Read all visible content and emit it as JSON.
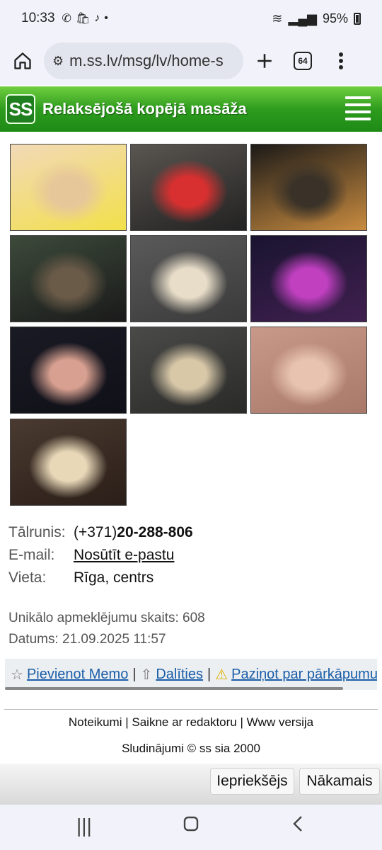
{
  "status": {
    "time": "10:33",
    "battery": "95%"
  },
  "browser": {
    "url": "m.ss.lv/msg/lv/home-s",
    "tab_count": "64"
  },
  "header": {
    "logo": "SS",
    "title": "Relaksējošā kopējā masāža"
  },
  "photos": [
    {
      "alt": "photo-1",
      "colors": [
        "#f2d9b8",
        "#e6c79a",
        "#f2e04a"
      ]
    },
    {
      "alt": "photo-2",
      "colors": [
        "#5a5550",
        "#d83030",
        "#222"
      ]
    },
    {
      "alt": "photo-3",
      "colors": [
        "#1c1a18",
        "#3a3228",
        "#c98c40"
      ]
    },
    {
      "alt": "photo-4",
      "colors": [
        "#3c4a3a",
        "#6a5a48",
        "#1a1a1a"
      ]
    },
    {
      "alt": "photo-5",
      "colors": [
        "#5a5a5a",
        "#e8ddc8",
        "#3a3a3a"
      ]
    },
    {
      "alt": "photo-6",
      "colors": [
        "#1a1430",
        "#c040c0",
        "#402050"
      ]
    },
    {
      "alt": "photo-7",
      "colors": [
        "#1a1a24",
        "#d8a090",
        "#101018"
      ]
    },
    {
      "alt": "photo-8",
      "colors": [
        "#4a4a48",
        "#d8c8a8",
        "#2a2a28"
      ]
    },
    {
      "alt": "photo-9",
      "colors": [
        "#c89888",
        "#e8c4b0",
        "#a87868"
      ]
    },
    {
      "alt": "photo-10",
      "colors": [
        "#4a3a30",
        "#e8d8b8",
        "#2a1e18"
      ]
    }
  ],
  "info": {
    "phone_label": "Tālrunis:",
    "phone_prefix": "(+371)",
    "phone_number": "20-288-806",
    "email_label": "E-mail:",
    "email_link": "Nosūtīt e-pastu",
    "location_label": "Vieta:",
    "location_value": "Rīga, centrs"
  },
  "stats": {
    "visits": "Unikālo apmeklējumu skaits: 608",
    "date": "Datums: 21.09.2025 11:57"
  },
  "actions": {
    "memo": "Pievienot Memo",
    "share": "Dalīties",
    "report": "Paziņot par pārkāpumu",
    "separator": "|"
  },
  "footer": {
    "rules": "Noteikumi",
    "editor": "Saikne ar redaktoru",
    "web": "Www versija",
    "separator": "|",
    "copyright": "Sludinājumi © ss sia 2000"
  },
  "nav": {
    "prev": "Iepriekšējs",
    "next": "Nākamais"
  }
}
